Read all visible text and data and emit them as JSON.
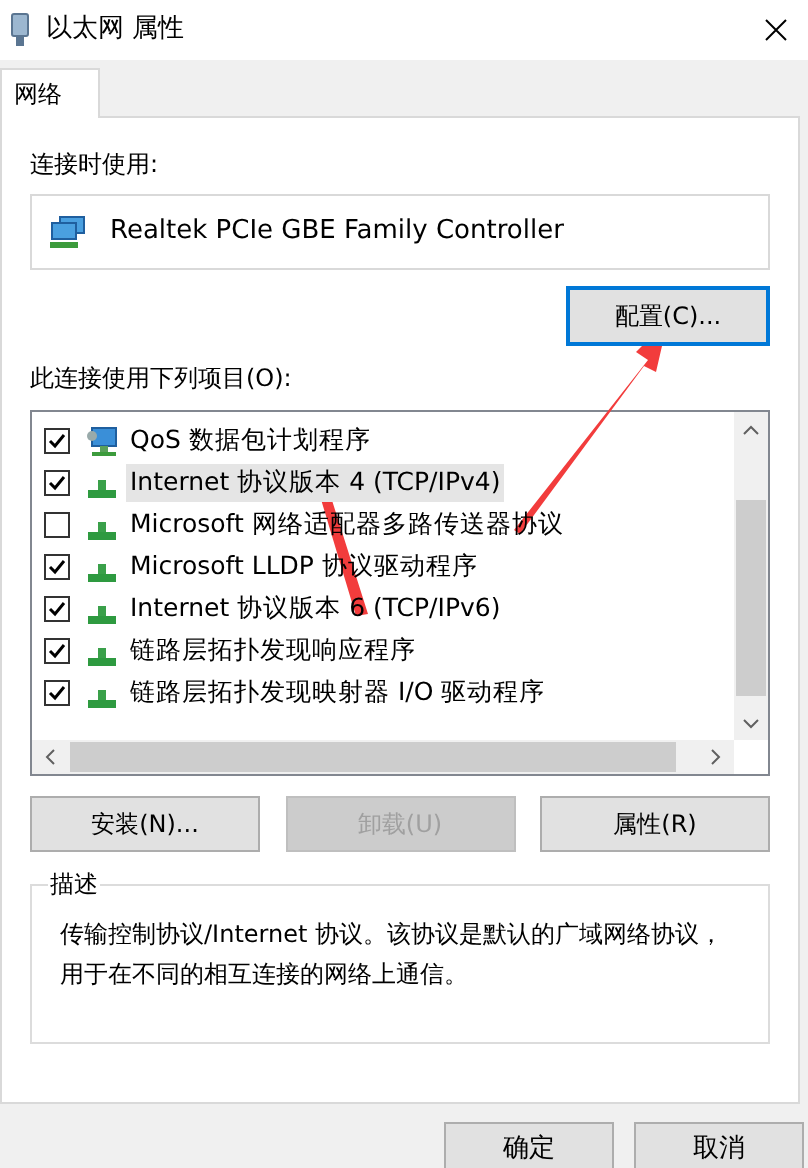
{
  "window": {
    "title": "以太网 属性"
  },
  "tabs": [
    {
      "label": "网络",
      "selected": true
    }
  ],
  "connect_using": {
    "label": "连接时使用:",
    "adapter": "Realtek PCIe GBE Family Controller"
  },
  "configure_button": {
    "label": "配置(C)...",
    "focused": true
  },
  "items_label": "此连接使用下列项目(O):",
  "items": [
    {
      "label": "QoS 数据包计划程序",
      "checked": true,
      "selected": false,
      "kind": "service"
    },
    {
      "label": "Internet 协议版本 4 (TCP/IPv4)",
      "checked": true,
      "selected": true,
      "kind": "protocol"
    },
    {
      "label": "Microsoft 网络适配器多路传送器协议",
      "checked": false,
      "selected": false,
      "kind": "protocol"
    },
    {
      "label": "Microsoft LLDP 协议驱动程序",
      "checked": true,
      "selected": false,
      "kind": "protocol"
    },
    {
      "label": "Internet 协议版本 6 (TCP/IPv6)",
      "checked": true,
      "selected": false,
      "kind": "protocol"
    },
    {
      "label": "链路层拓扑发现响应程序",
      "checked": true,
      "selected": false,
      "kind": "protocol"
    },
    {
      "label": "链路层拓扑发现映射器 I/O 驱动程序",
      "checked": true,
      "selected": false,
      "kind": "protocol"
    }
  ],
  "item_buttons": [
    {
      "label": "安装(N)...",
      "disabled": false
    },
    {
      "label": "卸载(U)",
      "disabled": true
    },
    {
      "label": "属性(R)",
      "disabled": false
    }
  ],
  "description": {
    "title": "描述",
    "text": "传输控制协议/Internet 协议。该协议是默认的广域网络协议，用于在不同的相互连接的网络上通信。"
  },
  "dialog_buttons": [
    "确定",
    "取消"
  ]
}
